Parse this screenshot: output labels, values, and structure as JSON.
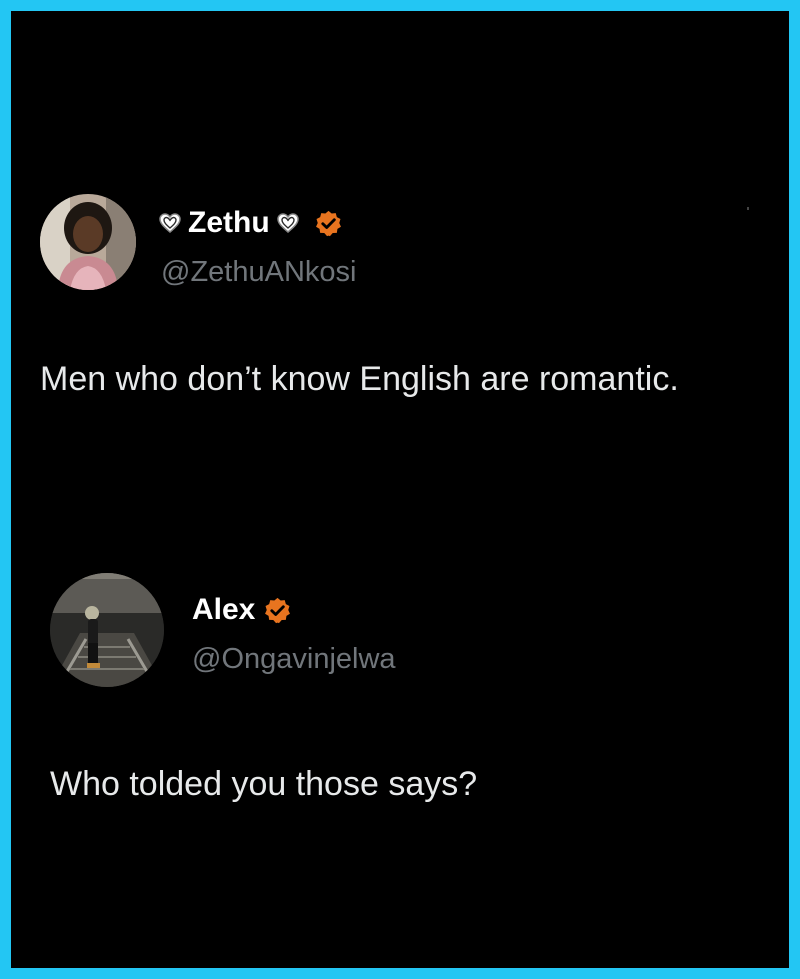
{
  "tweets": [
    {
      "display_name": "Zethu",
      "handle": "@ZethuANkosi",
      "text": "Men who don’t know English are romantic.",
      "verified": true,
      "name_decoration": "white-heart-icon"
    },
    {
      "display_name": "Alex",
      "handle": "@Ongavinjelwa",
      "text": "Who tolded you those says?",
      "verified": true
    }
  ],
  "colors": {
    "border": "#23c6f3",
    "background": "#000000",
    "text": "#e7e9ea",
    "handle": "#71767b",
    "badge": "#e8741f"
  }
}
